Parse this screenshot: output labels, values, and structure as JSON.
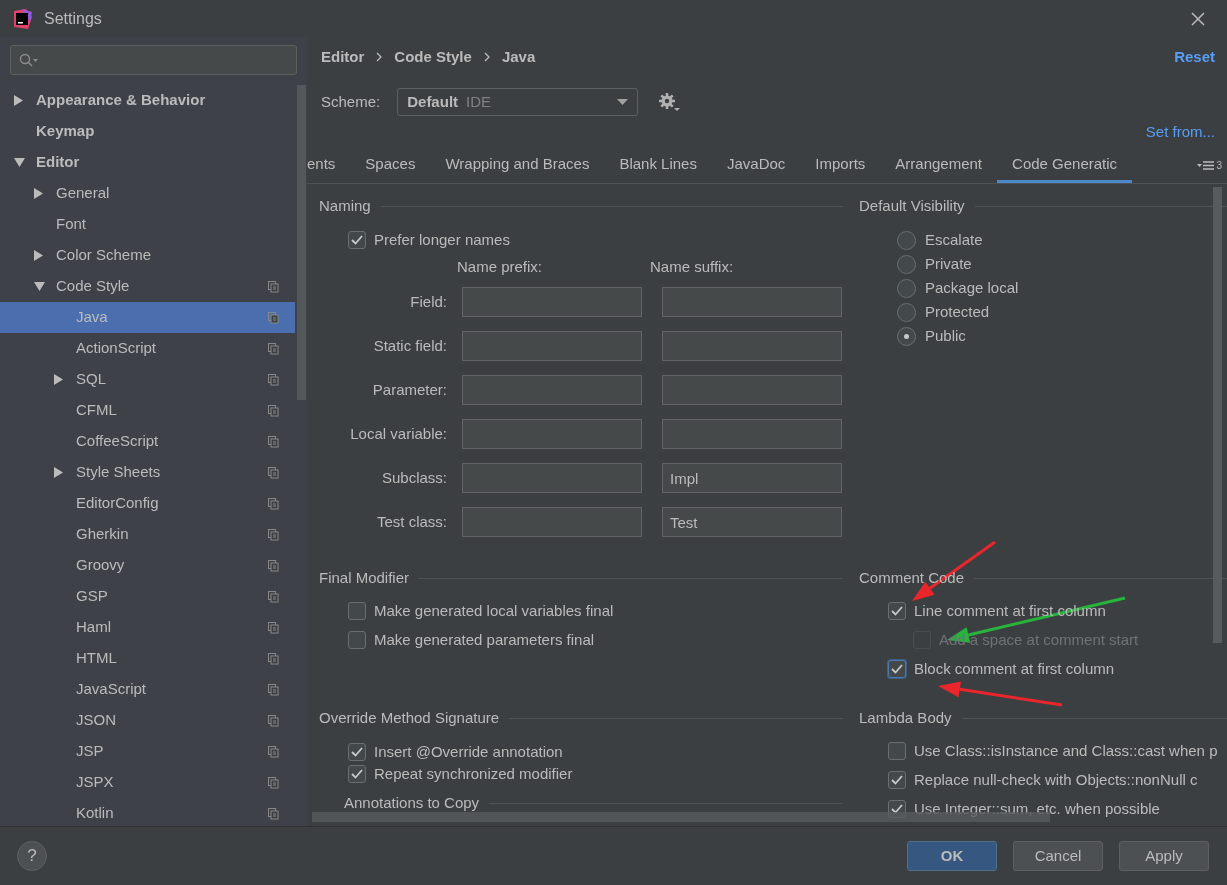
{
  "window": {
    "title": "Settings"
  },
  "sidebar": {
    "items": [
      {
        "label": "Appearance & Behavior",
        "expanded": false,
        "selected": false
      },
      {
        "label": "Keymap",
        "selected": false
      },
      {
        "label": "Editor",
        "expanded": true,
        "selected": false,
        "children": [
          {
            "label": "General",
            "expanded": false,
            "selected": false
          },
          {
            "label": "Font",
            "selected": false
          },
          {
            "label": "Color Scheme",
            "expanded": false,
            "selected": false
          },
          {
            "label": "Code Style",
            "expanded": true,
            "selected": false,
            "scheme_icon": true,
            "children": [
              {
                "label": "Java",
                "selected": true,
                "scheme_icon": true
              },
              {
                "label": "ActionScript",
                "selected": false,
                "scheme_icon": true
              },
              {
                "label": "SQL",
                "expanded": false,
                "selected": false,
                "scheme_icon": true
              },
              {
                "label": "CFML",
                "selected": false,
                "scheme_icon": true
              },
              {
                "label": "CoffeeScript",
                "selected": false,
                "scheme_icon": true
              },
              {
                "label": "Style Sheets",
                "expanded": false,
                "selected": false,
                "scheme_icon": true
              },
              {
                "label": "EditorConfig",
                "selected": false,
                "scheme_icon": true
              },
              {
                "label": "Gherkin",
                "selected": false,
                "scheme_icon": true
              },
              {
                "label": "Groovy",
                "selected": false,
                "scheme_icon": true
              },
              {
                "label": "GSP",
                "selected": false,
                "scheme_icon": true
              },
              {
                "label": "Haml",
                "selected": false,
                "scheme_icon": true
              },
              {
                "label": "HTML",
                "selected": false,
                "scheme_icon": true
              },
              {
                "label": "JavaScript",
                "selected": false,
                "scheme_icon": true
              },
              {
                "label": "JSON",
                "selected": false,
                "scheme_icon": true
              },
              {
                "label": "JSP",
                "selected": false,
                "scheme_icon": true
              },
              {
                "label": "JSPX",
                "selected": false,
                "scheme_icon": true
              },
              {
                "label": "Kotlin",
                "selected": false,
                "scheme_icon": true
              }
            ]
          }
        ]
      }
    ]
  },
  "breadcrumb": [
    "Editor",
    "Code Style",
    "Java"
  ],
  "reset": "Reset",
  "scheme": {
    "label": "Scheme:",
    "name": "Default",
    "type": "IDE"
  },
  "set_from": "Set from...",
  "tabs": [
    {
      "label": "ents",
      "selected": false
    },
    {
      "label": "Spaces",
      "selected": false
    },
    {
      "label": "Wrapping and Braces",
      "selected": false
    },
    {
      "label": "Blank Lines",
      "selected": false
    },
    {
      "label": "JavaDoc",
      "selected": false
    },
    {
      "label": "Imports",
      "selected": false
    },
    {
      "label": "Arrangement",
      "selected": false
    },
    {
      "label": "Code Generatic",
      "selected": true
    }
  ],
  "tab_overflow_count": "3",
  "naming": {
    "title": "Naming",
    "prefer_longer": {
      "label": "Prefer longer names",
      "checked": true
    },
    "columns": [
      "Name prefix:",
      "Name suffix:"
    ],
    "rows": [
      {
        "label": "Field:"
      },
      {
        "label": "Static field:"
      },
      {
        "label": "Parameter:"
      },
      {
        "label": "Local variable:"
      },
      {
        "label": "Subclass:",
        "suffix": "Impl"
      },
      {
        "label": "Test class:",
        "suffix": "Test"
      }
    ]
  },
  "default_visibility": {
    "title": "Default Visibility",
    "options": [
      {
        "label": "Escalate",
        "selected": false
      },
      {
        "label": "Private",
        "selected": false
      },
      {
        "label": "Package local",
        "selected": false
      },
      {
        "label": "Protected",
        "selected": false
      },
      {
        "label": "Public",
        "selected": true
      }
    ]
  },
  "final_modifier": {
    "title": "Final Modifier",
    "options": [
      {
        "label": "Make generated local variables final",
        "checked": false
      },
      {
        "label": "Make generated parameters final",
        "checked": false
      }
    ]
  },
  "comment_code": {
    "title": "Comment Code",
    "options": [
      {
        "label": "Line comment at first column",
        "checked": true,
        "disabled": false,
        "focused": false,
        "children": [
          {
            "label": "Add a space at comment start",
            "checked": false,
            "disabled": true,
            "focused": false
          }
        ]
      },
      {
        "label": "Block comment at first column",
        "checked": true,
        "disabled": false,
        "focused": true
      }
    ]
  },
  "override": {
    "title": "Override Method Signature",
    "options": [
      {
        "label": "Insert @Override annotation",
        "checked": true
      },
      {
        "label": "Repeat synchronized modifier",
        "checked": true
      }
    ],
    "subsection": "Annotations to Copy"
  },
  "lambda_body": {
    "title": "Lambda Body",
    "options": [
      {
        "label": "Use Class::isInstance and Class::cast when p",
        "checked": false
      },
      {
        "label": "Replace null-check with Objects::nonNull c",
        "checked": true
      },
      {
        "label": "Use Integer::sum, etc. when possible",
        "checked": true
      }
    ]
  },
  "help": "?",
  "buttons": [
    {
      "label": "OK",
      "kind": "default"
    },
    {
      "label": "Cancel",
      "kind": "normal"
    },
    {
      "label": "Apply",
      "kind": "normal"
    }
  ]
}
